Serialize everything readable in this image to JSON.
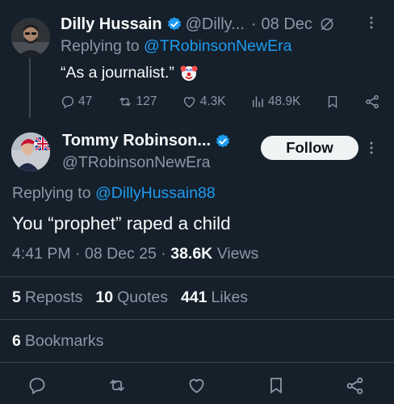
{
  "colors": {
    "background": "#15202b",
    "text": "#f7f9f9",
    "muted": "#8b98a5",
    "link": "#1d9bf0",
    "divider": "#38444d",
    "verified": "#1d9bf0"
  },
  "parent_tweet": {
    "display_name": "Dilly Hussain",
    "handle": "@Dilly...",
    "separator": "·",
    "date": "08 Dec",
    "replying_prefix": "Replying to",
    "replying_to": "@TRobinsonNewEra",
    "text": "“As a journalist.”",
    "emoji": "clown-face",
    "actions": {
      "replies": "47",
      "reposts": "127",
      "likes": "4.3K",
      "views": "48.9K"
    },
    "icons": [
      "verified-badge-icon",
      "globe-slash-icon",
      "more-icon",
      "reply-icon",
      "repost-icon",
      "like-icon",
      "views-icon",
      "bookmark-icon",
      "share-icon"
    ]
  },
  "main_tweet": {
    "display_name": "Tommy Robinson...",
    "handle": "@TRobinsonNewEra",
    "follow_label": "Follow",
    "replying_prefix": "Replying to",
    "replying_to": "@DillyHussain88",
    "text": "You “prophet” raped a child",
    "time": "4:41 PM",
    "date": "08 Dec 25",
    "views_count": "38.6K",
    "views_label": "Views",
    "meta_separator": "·",
    "stats": {
      "reposts_count": "5",
      "reposts_label": "Reposts",
      "quotes_count": "10",
      "quotes_label": "Quotes",
      "likes_count": "441",
      "likes_label": "Likes"
    },
    "bookmarks_count": "6",
    "bookmarks_label": "Bookmarks"
  }
}
